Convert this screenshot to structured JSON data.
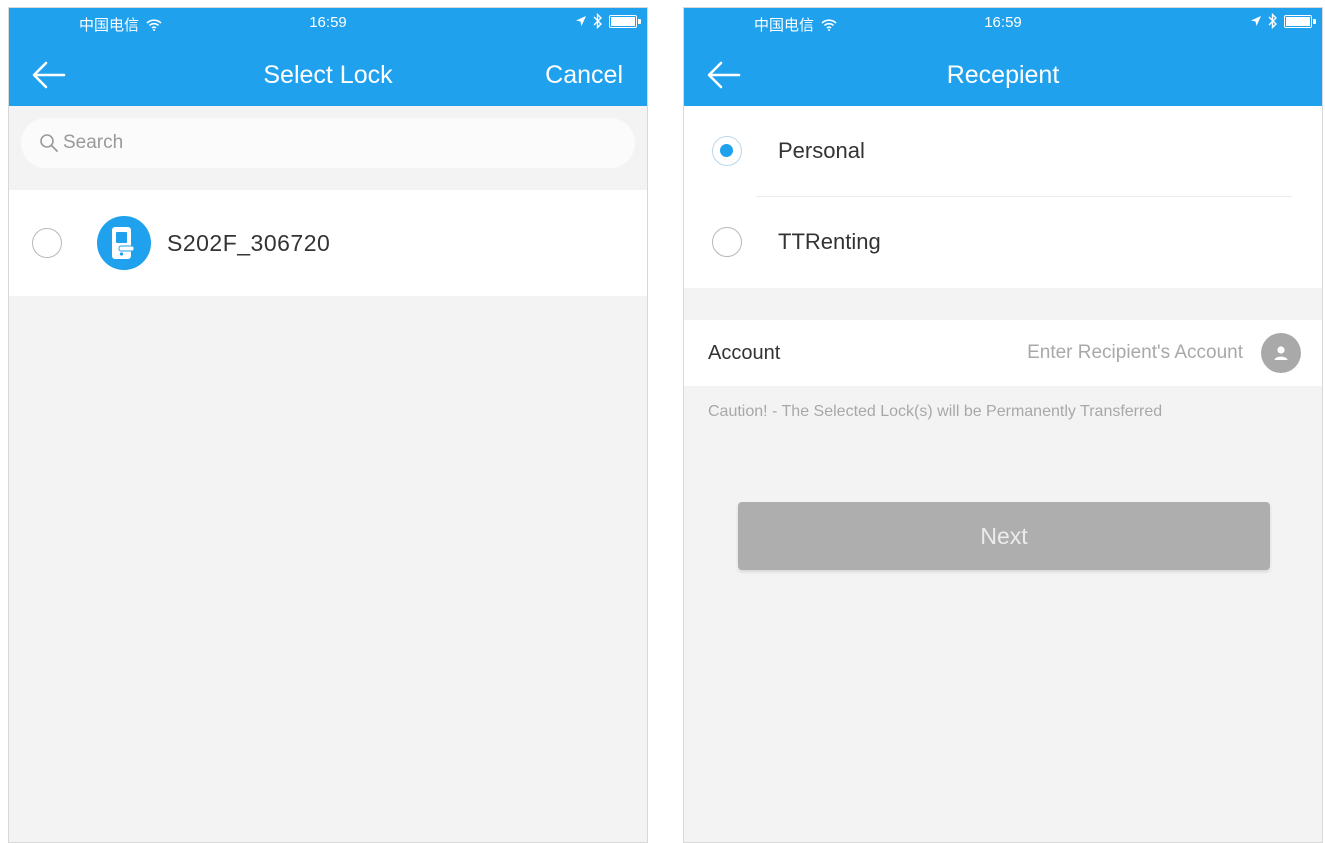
{
  "colors": {
    "header": "#1fa1ee",
    "accent": "#1fa1ee",
    "disabled_button": "#aeaeae"
  },
  "status_bar": {
    "carrier": "中国电信",
    "time": "16:59",
    "icons": [
      "wifi-icon",
      "location-arrow-icon",
      "bluetooth-icon",
      "battery-icon"
    ]
  },
  "select_lock": {
    "title": "Select Lock",
    "back_icon": "arrow-left-icon",
    "cancel_label": "Cancel",
    "search": {
      "placeholder": "Search",
      "value": "",
      "icon": "search-icon"
    },
    "locks": [
      {
        "name": "S202F_306720",
        "selected": false,
        "icon": "door-lock-icon"
      }
    ]
  },
  "recipient": {
    "title": "Recepient",
    "back_icon": "arrow-left-icon",
    "options": [
      {
        "label": "Personal",
        "selected": true
      },
      {
        "label": "TTRenting",
        "selected": false
      }
    ],
    "account": {
      "label": "Account",
      "placeholder": "Enter Recipient's Account",
      "value": "",
      "icon": "contact-person-icon"
    },
    "caution": "Caution! - The Selected Lock(s) will be Permanently Transferred",
    "next_label": "Next",
    "next_enabled": false
  }
}
